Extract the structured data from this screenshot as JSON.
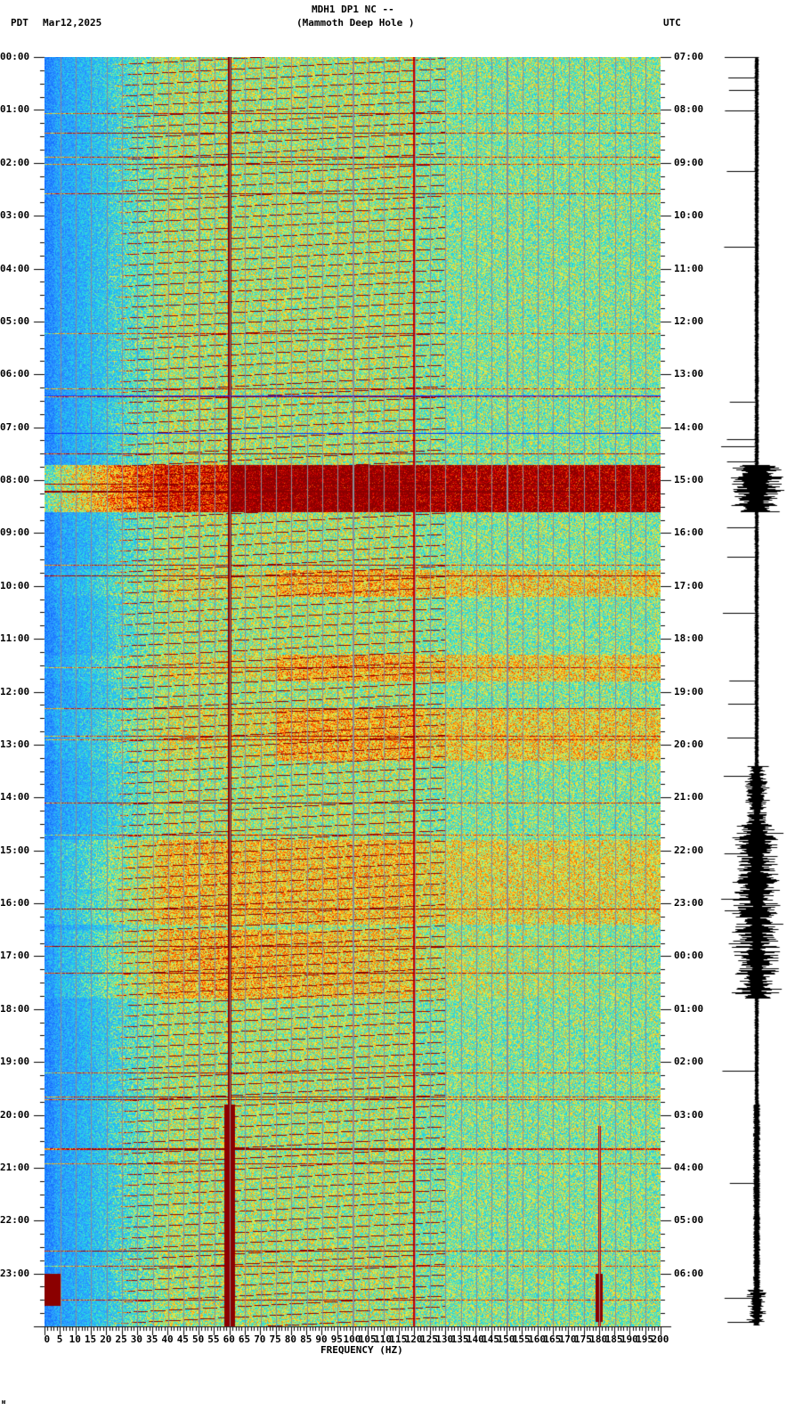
{
  "header": {
    "title": "MDH1 DP1 NC --",
    "subtitle": "(Mammoth Deep Hole )",
    "left_timezone": "PDT",
    "date": "Mar12,2025",
    "right_timezone": "UTC"
  },
  "footer_mark": "ᴍ",
  "chart_data": {
    "type": "heatmap",
    "title": "MDH1 DP1 NC -- (Mammoth Deep Hole )",
    "xlabel": "FREQUENCY (HZ)",
    "ylabel_left": "PDT",
    "ylabel_right": "UTC",
    "xlim": [
      0,
      200
    ],
    "ylim_hours": [
      0,
      24
    ],
    "x_ticks": [
      "0",
      "5",
      "10",
      "15",
      "20",
      "25",
      "30",
      "35",
      "40",
      "45",
      "50",
      "55",
      "60",
      "65",
      "70",
      "75",
      "80",
      "85",
      "90",
      "95",
      "100",
      "105",
      "110",
      "115",
      "120",
      "125",
      "130",
      "135",
      "140",
      "145",
      "150",
      "155",
      "160",
      "165",
      "170",
      "175",
      "180",
      "185",
      "190",
      "195",
      "200"
    ],
    "y_ticks_left": [
      "00:00",
      "01:00",
      "02:00",
      "03:00",
      "04:00",
      "05:00",
      "06:00",
      "07:00",
      "08:00",
      "09:00",
      "10:00",
      "11:00",
      "12:00",
      "13:00",
      "14:00",
      "15:00",
      "16:00",
      "17:00",
      "18:00",
      "19:00",
      "20:00",
      "21:00",
      "22:00",
      "23:00"
    ],
    "y_ticks_right": [
      "07:00",
      "08:00",
      "09:00",
      "10:00",
      "11:00",
      "12:00",
      "13:00",
      "14:00",
      "15:00",
      "16:00",
      "17:00",
      "18:00",
      "19:00",
      "20:00",
      "21:00",
      "22:00",
      "23:00",
      "00:00",
      "01:00",
      "02:00",
      "03:00",
      "04:00",
      "05:00",
      "06:00"
    ],
    "colormap": [
      "#1060ff",
      "#30a0ff",
      "#20e0e0",
      "#f0f040",
      "#ff8000",
      "#e00000",
      "#8b0000"
    ],
    "notable_lines_hz": [
      60,
      120,
      180
    ],
    "events_pdt_hours": [
      [
        7.7,
        8.6
      ],
      [
        9.7,
        10.2
      ],
      [
        11.3,
        11.8
      ],
      [
        12.3,
        13.3
      ],
      [
        14.8,
        16.4
      ],
      [
        16.5,
        17.8
      ]
    ]
  }
}
